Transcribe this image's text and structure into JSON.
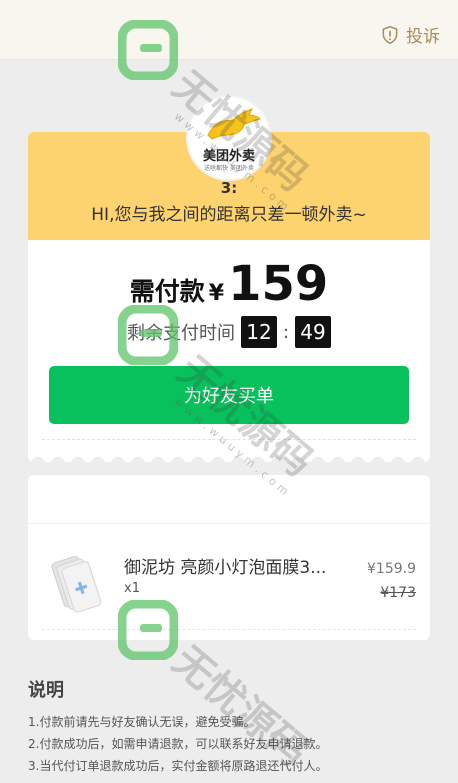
{
  "header": {
    "complaint_label": "投诉"
  },
  "logo": {
    "brand": "美团外卖",
    "tagline": "送啥都快 美团外卖"
  },
  "payer": {
    "name": "3:",
    "message": "HI,您与我之间的距离只差一顿外卖~"
  },
  "payment": {
    "amount_label": "需付款",
    "currency": "¥",
    "amount": "159",
    "timer_label": "剩余支付时间",
    "timer_minutes": "12",
    "timer_separator": ":",
    "timer_seconds": "49",
    "button_label": "为好友买单"
  },
  "product": {
    "name": "御泥坊 亮颜小灯泡面膜3...",
    "quantity": "x1",
    "price": "¥159.9",
    "original_price": "¥173"
  },
  "notes": {
    "title": "说明",
    "items": [
      "1.付款前请先与好友确认无误，避免受骗。",
      "2.付款成功后，如需申请退款，可以联系好友申请退款。",
      "3.当代付订单退款成功后，实付金额将原路退还代付人。"
    ]
  },
  "watermark": {
    "text": "无忧源码",
    "url": "www.wuuym.com"
  },
  "colors": {
    "accent_green": "#09c15c",
    "header_yellow": "#fdd36f",
    "complaint_gold": "#a98c5c",
    "watermark_green": "#5ec46a"
  }
}
